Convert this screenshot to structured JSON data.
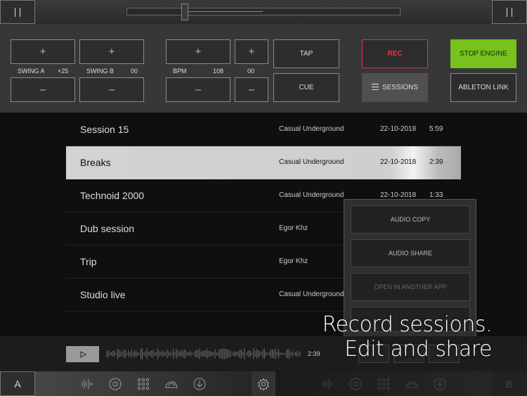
{
  "top_bar": {
    "left_button_icon": "pause-icon",
    "right_button_icon": "pause-icon",
    "crossfader_position": 0.22
  },
  "controls": {
    "plus_symbol": "+",
    "minus_symbol": "–",
    "swing_a": {
      "label": "SWING A",
      "value": "+25"
    },
    "swing_b": {
      "label": "SWING B",
      "value": "00"
    },
    "bpm": {
      "label": "BPM",
      "value": "108"
    },
    "nudge": {
      "value": "00"
    },
    "tap_label": "TAP",
    "cue_label": "CUE",
    "rec_label": "REC",
    "sessions_label": "SESSIONS",
    "stop_engine_label": "STOP ENGINE",
    "ableton_link_label": "ABLETON LINK"
  },
  "sessions": [
    {
      "name": "Session 15",
      "artist": "Casual Underground",
      "date": "22-10-2018",
      "duration": "5:59",
      "selected": false
    },
    {
      "name": "Breaks",
      "artist": "Casual Underground",
      "date": "22-10-2018",
      "duration": "2:39",
      "selected": true
    },
    {
      "name": "Technoid 2000",
      "artist": "Casual Underground",
      "date": "22-10-2018",
      "duration": "1:33",
      "selected": false
    },
    {
      "name": "Dub session",
      "artist": "Egor Khz",
      "date": "",
      "duration": "",
      "selected": false
    },
    {
      "name": "Trip",
      "artist": "Egor Khz",
      "date": "",
      "duration": "",
      "selected": false
    },
    {
      "name": "Studio live",
      "artist": "Casual Underground",
      "date": "",
      "duration": "",
      "selected": false
    }
  ],
  "context_menu": {
    "items": [
      "AUDIO COPY",
      "AUDIO SHARE",
      "OPEN IN ANOTHER APP"
    ]
  },
  "player": {
    "time": "2:39"
  },
  "bottom_bar": {
    "deck_a_label": "A",
    "deck_b_label": "B",
    "tools": [
      "waveform-icon",
      "record-disc-icon",
      "pads-grid-icon",
      "turntable-icon",
      "download-icon"
    ],
    "settings_icon": "gear-icon"
  },
  "promo": {
    "line1": "Record sessions.",
    "line2": "Edit and share"
  },
  "colors": {
    "rec_red": "#ff2a36",
    "stop_engine_green": "#78c21e",
    "selected_row": "#d2d2d2"
  }
}
